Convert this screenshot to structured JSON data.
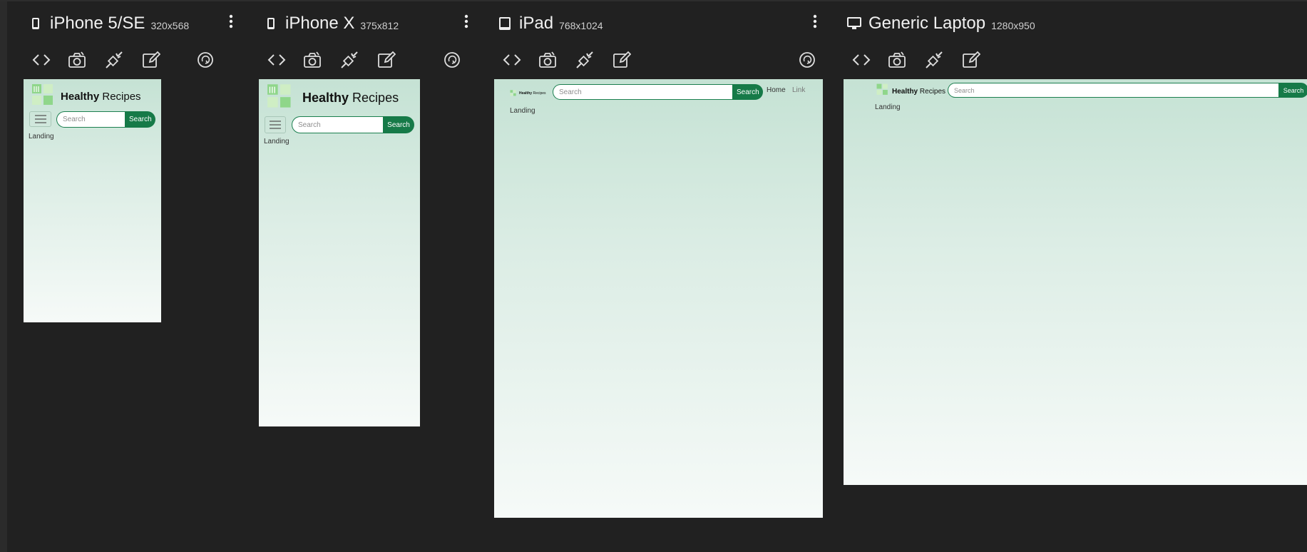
{
  "devices": [
    {
      "name": "iPhone 5/SE",
      "size": "320x568",
      "type": "phone"
    },
    {
      "name": "iPhone X",
      "size": "375x812",
      "type": "phone"
    },
    {
      "name": "iPad",
      "size": "768x1024",
      "type": "tablet"
    },
    {
      "name": "Generic Laptop",
      "size": "1280x950",
      "type": "laptop"
    }
  ],
  "site": {
    "brand_bold": "Healthy",
    "brand_rest": "Recipes",
    "search_placeholder": "Search",
    "search_button": "Search",
    "landing": "Landing",
    "nav": [
      "Home",
      "Link"
    ]
  },
  "toolbar_icons": [
    "code-icon",
    "camera-icon",
    "plug-icon",
    "edit-icon",
    "rotate-icon"
  ],
  "colors": {
    "background": "#212121",
    "accent": "#167a48",
    "viewport_top": "#c5e2d4",
    "viewport_bottom": "#f6faf8"
  }
}
